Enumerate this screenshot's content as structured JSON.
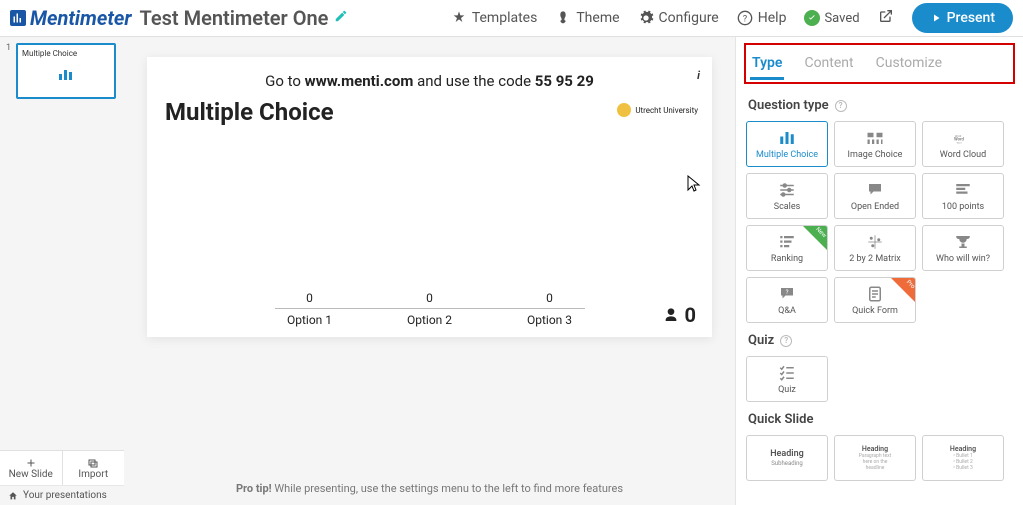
{
  "header": {
    "logo": "Mentimeter",
    "title": "Test Mentimeter One",
    "templates": "Templates",
    "theme": "Theme",
    "configure": "Configure",
    "help": "Help",
    "saved": "Saved",
    "present": "Present"
  },
  "sidebar": {
    "thumbs": [
      {
        "num": "1",
        "title": "Multiple Choice"
      }
    ],
    "new_slide": "New Slide",
    "import": "Import",
    "your_presentations": "Your presentations"
  },
  "slide": {
    "code_prefix": "Go to ",
    "code_url": "www.menti.com",
    "code_mid": " and use the code ",
    "code": "55 95 29",
    "heading": "Multiple Choice",
    "uni": "Utrecht University",
    "options": [
      {
        "value": "0",
        "label": "Option 1"
      },
      {
        "value": "0",
        "label": "Option 2"
      },
      {
        "value": "0",
        "label": "Option 3"
      }
    ],
    "participants": "0",
    "info": "i"
  },
  "protip": {
    "bold": "Pro tip! ",
    "rest": "While presenting, use the settings menu to the left to find more features"
  },
  "tabs": {
    "type": "Type",
    "content": "Content",
    "customize": "Customize"
  },
  "panel": {
    "question_type": "Question type",
    "quiz": "Quiz",
    "quick_slide": "Quick Slide",
    "types": {
      "multiple_choice": "Multiple Choice",
      "image_choice": "Image Choice",
      "word_cloud": "Word Cloud",
      "scales": "Scales",
      "open_ended": "Open Ended",
      "points100": "100 points",
      "ranking": "Ranking",
      "matrix": "2 by 2 Matrix",
      "who_win": "Who will win?",
      "qa": "Q&A",
      "quick_form": "Quick Form",
      "quiz_card": "Quiz"
    },
    "badges": {
      "new": "New",
      "pro": "Pro"
    },
    "qs": {
      "heading": "Heading",
      "sub": "Subheading",
      "para1": "Paragraph text",
      "para2": "here on the",
      "para3": "headline",
      "b1": "• Bullet 1",
      "b2": "• Bullet 2",
      "b3": "• Bullet 3"
    }
  },
  "chart_data": {
    "type": "bar",
    "categories": [
      "Option 1",
      "Option 2",
      "Option 3"
    ],
    "values": [
      0,
      0,
      0
    ],
    "title": "Multiple Choice",
    "xlabel": "",
    "ylabel": "",
    "ylim": [
      0,
      1
    ]
  }
}
